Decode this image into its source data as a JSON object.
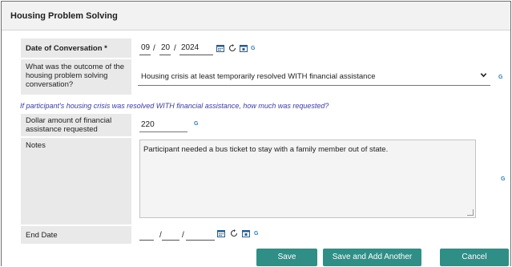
{
  "header": {
    "title": "Housing Problem Solving"
  },
  "fields": {
    "date": {
      "label": "Date of Conversation *",
      "month": "09",
      "day": "20",
      "year": "2024",
      "sep1": "/",
      "sep2": "/"
    },
    "outcome": {
      "label": "What was the outcome of the housing problem solving conversation?",
      "value": "Housing crisis at least temporarily resolved WITH financial assistance"
    },
    "hint": "If participant's housing crisis was resolved WITH financial assistance, how much was requested?",
    "dollar": {
      "label": "Dollar amount of financial assistance requested",
      "value": "220"
    },
    "notes": {
      "label": "Notes",
      "value": "Participant needed a bus ticket to stay with a family member out of state."
    },
    "end_date": {
      "label": "End Date",
      "month": "",
      "day": "",
      "year": "",
      "sep1": "/",
      "sep2": "/"
    }
  },
  "badge": "G",
  "buttons": {
    "save": "Save",
    "save_add": "Save and Add Another",
    "cancel": "Cancel"
  },
  "colors": {
    "button": "#2f8f86",
    "hint": "#3a3aa4",
    "badge": "#2e7db8"
  },
  "icons": [
    "calendar-icon",
    "reset-icon",
    "today-icon",
    "chevron-down-icon"
  ]
}
